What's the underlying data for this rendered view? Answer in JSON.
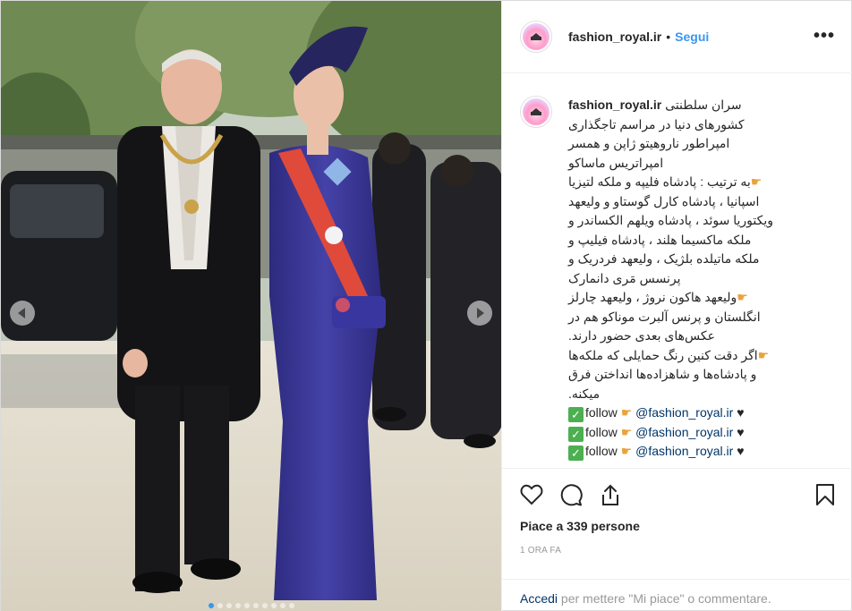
{
  "header": {
    "username": "fashion_royal.ir",
    "separator": "•",
    "follow": "Segui",
    "more": "•••"
  },
  "caption": {
    "username": "fashion_royal.ir",
    "lines": [
      "سران سلطنتی",
      "کشورهای دنیا در مراسم تاجگذاری",
      "امپراطور ناروهیتو ژاپن و همسر",
      "امپراتریس ماساکو",
      "به ترتیب : پادشاه فلیپه و ملکه لتیزیا",
      "اسپانیا ، پادشاه کارل گوستاو و ولیعهد",
      "ویکتوریا سوئد ، پادشاه ویلهم الکساندر و",
      "ملکه ماکسیما هلند ، پادشاه فیلیپ و",
      "ملکه ماتیلده بلژیک ، ولیعهد فردریک و",
      "پرنسس مَری دانمارک",
      "ولیعهد هاکون نروژ ، ولیعهد چارلز",
      "انگلستان و پرنس آلبرت موناکو هم در",
      "عکس‌های بعدی حضور دارند.",
      "اگر دقت کنین رنگ حمایلی که ملکه‌ها",
      "و پادشاه‌ها و شاهزاده‌ها انداختن فرق",
      "میکنه."
    ],
    "follow_lines": [
      {
        "word": "follow",
        "mention": "@fashion_royal.ir"
      },
      {
        "word": "follow",
        "mention": "@fashion_royal.ir"
      },
      {
        "word": "follow",
        "mention": "@fashion_royal.ir"
      }
    ]
  },
  "actions": {
    "likes": "Piace a 339 persone",
    "time": "1 ORA FA"
  },
  "login": {
    "link": "Accedi",
    "rest": " per mettere \"Mi piace\" o commentare."
  },
  "icons": {
    "like": "heart-icon",
    "comment": "comment-icon",
    "share": "share-icon",
    "save": "bookmark-icon"
  },
  "colors": {
    "link": "#3897f0",
    "dress": "#3d3a9a",
    "sash": "#e04a3a"
  }
}
